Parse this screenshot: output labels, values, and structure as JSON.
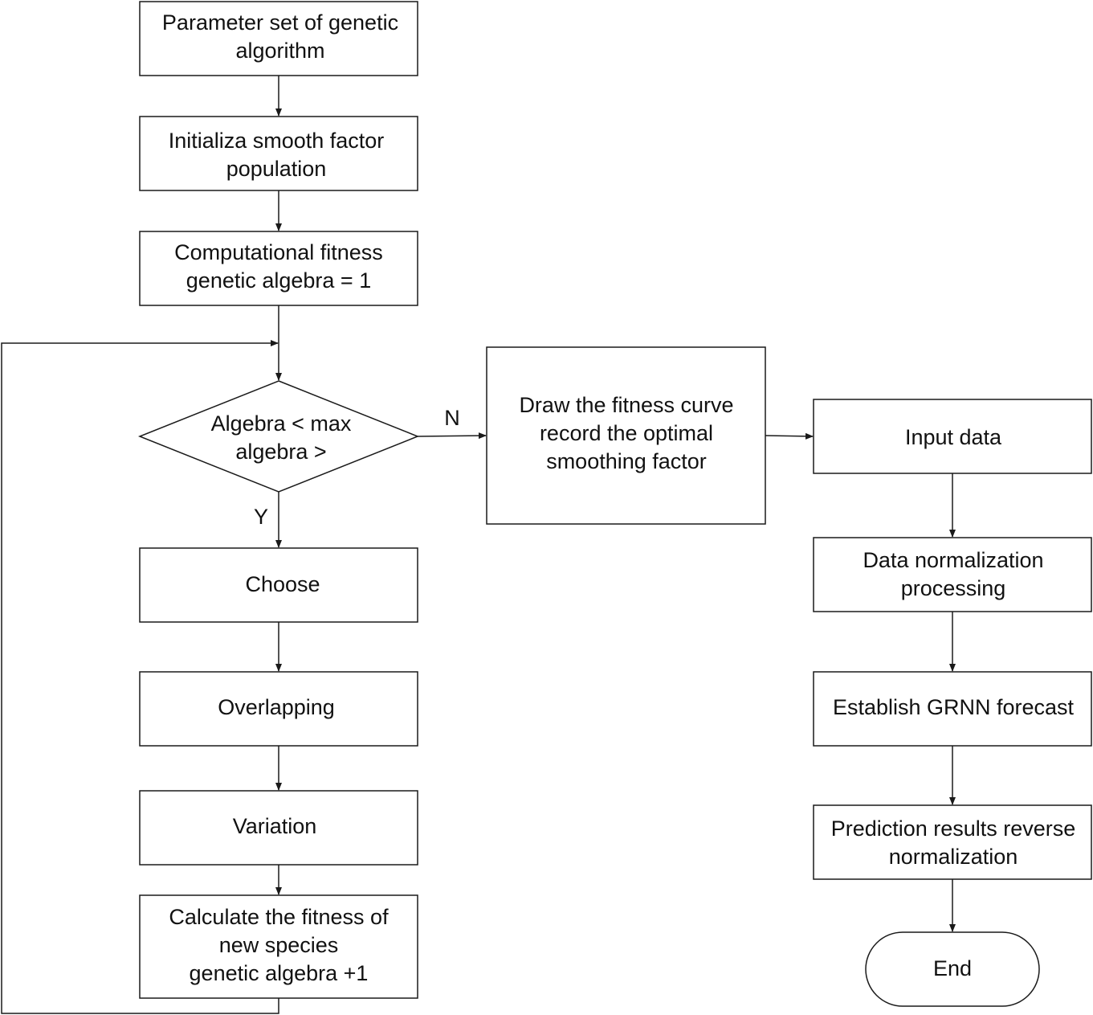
{
  "nodes": {
    "param_set": [
      "Parameter set of genetic",
      "algorithm"
    ],
    "init_pop": [
      "Initializa smooth factor",
      "population"
    ],
    "comp_fitness": [
      "Computational fitness",
      "genetic algebra = 1"
    ],
    "decision": [
      "Algebra < max",
      "algebra >"
    ],
    "choose": [
      "Choose"
    ],
    "overlapping": [
      "Overlapping"
    ],
    "variation": [
      "Variation"
    ],
    "calc_fitness": [
      "Calculate the fitness of",
      "new species",
      "genetic algebra +1"
    ],
    "draw_curve": [
      "Draw the fitness curve",
      "record the optimal",
      "smoothing factor"
    ],
    "input_data": [
      "Input data"
    ],
    "normalization": [
      "Data normalization",
      "processing"
    ],
    "grnn": [
      "Establish GRNN forecast"
    ],
    "reverse_norm": [
      "Prediction results reverse",
      "normalization"
    ],
    "end": [
      "End"
    ]
  },
  "edge_labels": {
    "no": "N",
    "yes": "Y"
  },
  "colors": {
    "stroke": "#1a1a1a",
    "background": "#ffffff"
  }
}
